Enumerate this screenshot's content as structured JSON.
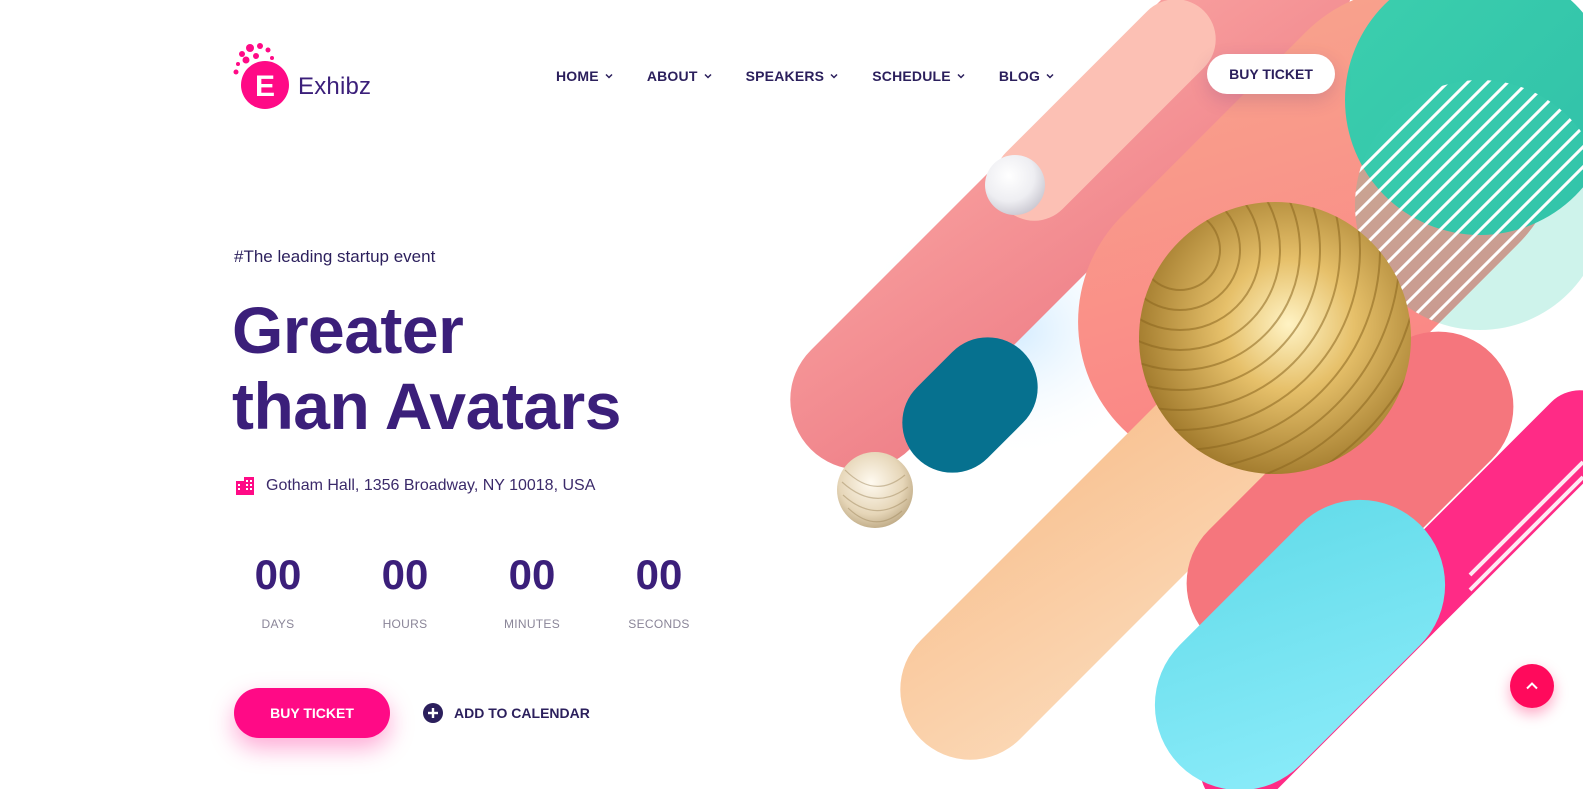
{
  "brand": {
    "name": "Exhibz",
    "logo_letter": "E",
    "color": "#ff0a86"
  },
  "nav": {
    "items": [
      {
        "label": "HOME",
        "icon": "chevron-down-icon"
      },
      {
        "label": "ABOUT",
        "icon": "chevron-down-icon"
      },
      {
        "label": "SPEAKERS",
        "icon": "chevron-down-icon"
      },
      {
        "label": "SCHEDULE",
        "icon": "chevron-down-icon"
      },
      {
        "label": "BLOG",
        "icon": "chevron-down-icon"
      }
    ],
    "buy_ticket_label": "BUY TICKET"
  },
  "hero": {
    "tagline": "#The leading startup event",
    "title_line1": "Greater",
    "title_line2": "than Avatars",
    "venue_icon": "building-icon",
    "venue": "Gotham Hall, 1356 Broadway, NY 10018, USA"
  },
  "countdown": {
    "days": {
      "value": "00",
      "label": "DAYS"
    },
    "hours": {
      "value": "00",
      "label": "HOURS"
    },
    "minutes": {
      "value": "00",
      "label": "MINUTES"
    },
    "seconds": {
      "value": "00",
      "label": "SECONDS"
    }
  },
  "cta": {
    "buy_ticket_label": "BUY TICKET",
    "add_to_calendar_label": "ADD TO CALENDAR",
    "add_icon": "plus-circle-icon"
  },
  "scroll_top_icon": "chevron-up-icon",
  "colors": {
    "primary": "#3b1f7a",
    "accent": "#ff0a86",
    "teal": "#06718f",
    "coral": "#f47b7f",
    "peach": "#fbd3a8",
    "cyan": "#7ee8f6",
    "mint": "#3ccfae",
    "gold": "#d9b25a"
  }
}
